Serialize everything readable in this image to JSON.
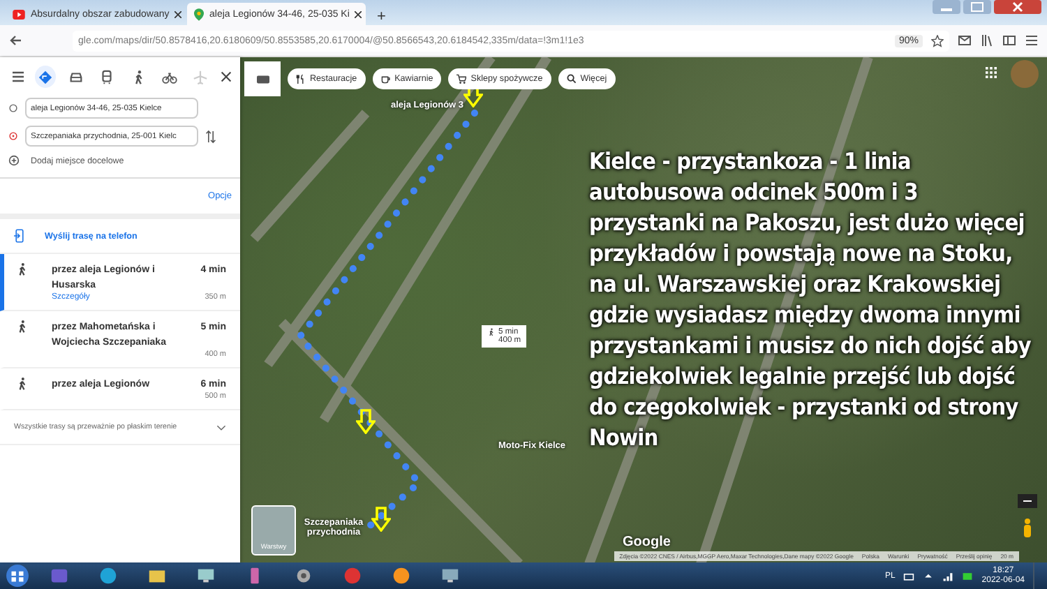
{
  "browser": {
    "tabs": [
      {
        "title": "Absurdalny obszar zabudowany",
        "selected": false
      },
      {
        "title": "aleja Legionów 34-46, 25-035 Ki",
        "selected": true
      }
    ],
    "new_tab": "+",
    "url": "gle.com/maps/dir/50.8578416,20.6180609/50.8553585,20.6170004/@50.8566543,20.6184542,335m/data=!3m1!1e3",
    "zoom": "90%"
  },
  "directions": {
    "modes": [
      {
        "kind": "best",
        "selected": true,
        "disabled": false
      },
      {
        "kind": "car",
        "selected": false,
        "disabled": false
      },
      {
        "kind": "transit",
        "selected": false,
        "disabled": false
      },
      {
        "kind": "walk",
        "selected": false,
        "disabled": false
      },
      {
        "kind": "bike",
        "selected": false,
        "disabled": false
      },
      {
        "kind": "flight",
        "selected": false,
        "disabled": true
      }
    ],
    "origin": "aleja Legionów 34-46, 25-035 Kielce",
    "destination": "Szczepaniaka przychodnia, 25-001 Kielc",
    "add_destination": "Dodaj miejsce docelowe",
    "options_link": "Opcje",
    "send_to_phone": "Wyślij trasę na telefon",
    "routes": [
      {
        "name": "przez aleja Legionów i Husarska",
        "time": "4 min",
        "distance": "350 m",
        "details_link": "Szczegóły",
        "selected": true
      },
      {
        "name": "przez Mahometańska i Wojciecha Szczepaniaka",
        "time": "5 min",
        "distance": "400 m",
        "selected": false
      },
      {
        "name": "przez aleja Legionów",
        "time": "6 min",
        "distance": "500 m",
        "selected": false
      }
    ],
    "footer": "Wszystkie trasy są przeważnie po płaskim terenie"
  },
  "map": {
    "chips": [
      {
        "kind": "restaurant",
        "label": "Restauracje"
      },
      {
        "kind": "cafe",
        "label": "Kawiarnie"
      },
      {
        "kind": "grocery",
        "label": "Sklepy spożywcze"
      },
      {
        "kind": "more",
        "label": "Więcej"
      }
    ],
    "labels": [
      "aleja Legionów 3",
      "Szczepaniaka przychodnia",
      "Moto-Fix Kielce"
    ],
    "route_bubble": {
      "time": "5 min",
      "distance": "400 m"
    },
    "caption": "Kielce - przystankoza - 1 linia autobusowa odcinek 500m i 3 przystanki na Pakoszu, jest dużo więcej przykładów i powstają nowe na Stoku, na ul. Warszawskiej oraz Krakowskiej gdzie wysiadasz między dwoma innymi przystankami i musisz do nich dojść aby gdziekolwiek legalnie przejść lub dojść do czegokolwiek - przystanki od strony Nowin",
    "layers_label": "Warstwy",
    "logo": "Google",
    "attribution": [
      "Zdjęcia ©2022 CNES / Airbus,MGGP Aero,Maxar Technologies,Dane mapy ©2022 Google",
      "Polska",
      "Warunki",
      "Prywatność",
      "Prześlij opinię",
      "20 m"
    ]
  },
  "taskbar": {
    "language": "PL",
    "time": "18:27",
    "date": "2022-06-04"
  }
}
